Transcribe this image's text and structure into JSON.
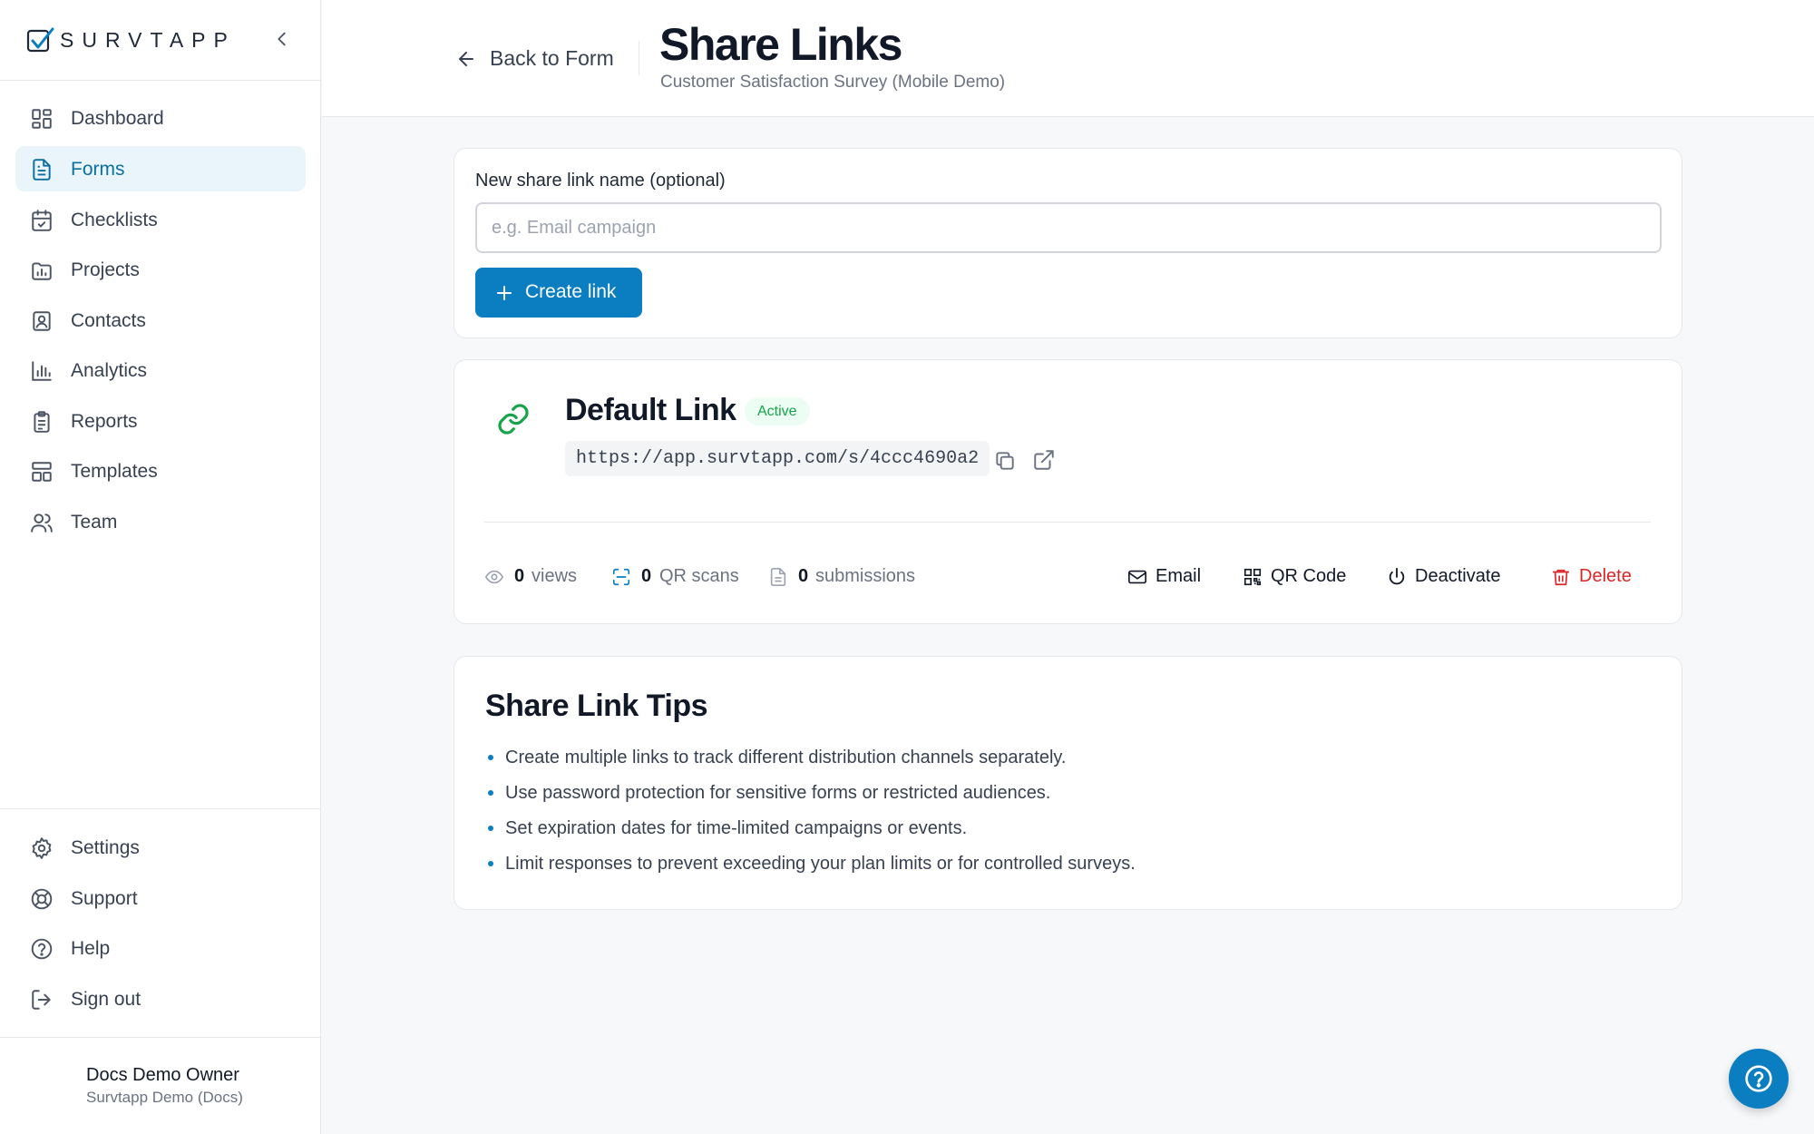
{
  "brand": {
    "name": "SURVTAPP",
    "logo_icon": "check-box-logo"
  },
  "sidebar": {
    "collapse_icon": "chevron-left-icon",
    "items": [
      {
        "label": "Dashboard",
        "icon": "dashboard-icon",
        "active": false
      },
      {
        "label": "Forms",
        "icon": "file-text-icon",
        "active": true
      },
      {
        "label": "Checklists",
        "icon": "calendar-check-icon",
        "active": false
      },
      {
        "label": "Projects",
        "icon": "folder-chart-icon",
        "active": false
      },
      {
        "label": "Contacts",
        "icon": "contact-icon",
        "active": false
      },
      {
        "label": "Analytics",
        "icon": "bar-chart-icon",
        "active": false
      },
      {
        "label": "Reports",
        "icon": "clipboard-icon",
        "active": false
      },
      {
        "label": "Templates",
        "icon": "layout-icon",
        "active": false
      },
      {
        "label": "Team",
        "icon": "users-icon",
        "active": false
      }
    ],
    "bottom_items": [
      {
        "label": "Settings",
        "icon": "gear-icon"
      },
      {
        "label": "Support",
        "icon": "lifebuoy-icon"
      },
      {
        "label": "Help",
        "icon": "help-circle-icon"
      },
      {
        "label": "Sign out",
        "icon": "sign-out-icon"
      }
    ],
    "user": {
      "name": "Docs Demo Owner",
      "org": "Survtapp Demo (Docs)"
    }
  },
  "header": {
    "back_label": "Back to Form",
    "title": "Share Links",
    "subtitle": "Customer Satisfaction Survey (Mobile Demo)"
  },
  "create": {
    "label": "New share link name (optional)",
    "placeholder": "e.g. Email campaign",
    "value": "",
    "button_label": "Create link"
  },
  "link": {
    "name": "Default Link",
    "status": "Active",
    "url": "https://app.survtapp.com/s/4ccc4690a2",
    "stats": {
      "views": {
        "count": "0",
        "label": "views"
      },
      "qr_scans": {
        "count": "0",
        "label": "QR scans"
      },
      "submissions": {
        "count": "0",
        "label": "submissions"
      }
    },
    "actions": {
      "email": "Email",
      "qr_code": "QR Code",
      "deactivate": "Deactivate",
      "delete": "Delete"
    }
  },
  "tips": {
    "title": "Share Link Tips",
    "items": [
      "Create multiple links to track different distribution channels separately.",
      "Use password protection for sensitive forms or restricted audiences.",
      "Set expiration dates for time-limited campaigns or events.",
      "Limit responses to prevent exceeding your plan limits or for controlled surveys."
    ]
  },
  "colors": {
    "accent": "#0b7dc1",
    "active_nav_bg": "#eaf4fb",
    "success": "#16a34a",
    "danger": "#dc2626"
  }
}
